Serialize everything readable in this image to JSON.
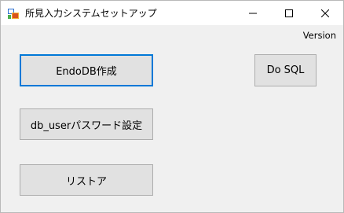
{
  "window": {
    "title": "所見入力システムセットアップ",
    "app_icon": "form-app-icon",
    "controls": {
      "minimize_icon": "minimize-icon",
      "maximize_icon": "maximize-icon",
      "close_icon": "close-icon"
    }
  },
  "menu": {
    "items": [
      {
        "label": "Version"
      }
    ]
  },
  "buttons": {
    "endodb": "EndoDB作成",
    "db_user_password": "db_userパスワード設定",
    "restore": "リストア",
    "do_sql": "Do SQL"
  },
  "colors": {
    "focus_border": "#0078d7",
    "button_face": "#e1e1e1",
    "window_bg": "#f0f0f0"
  }
}
